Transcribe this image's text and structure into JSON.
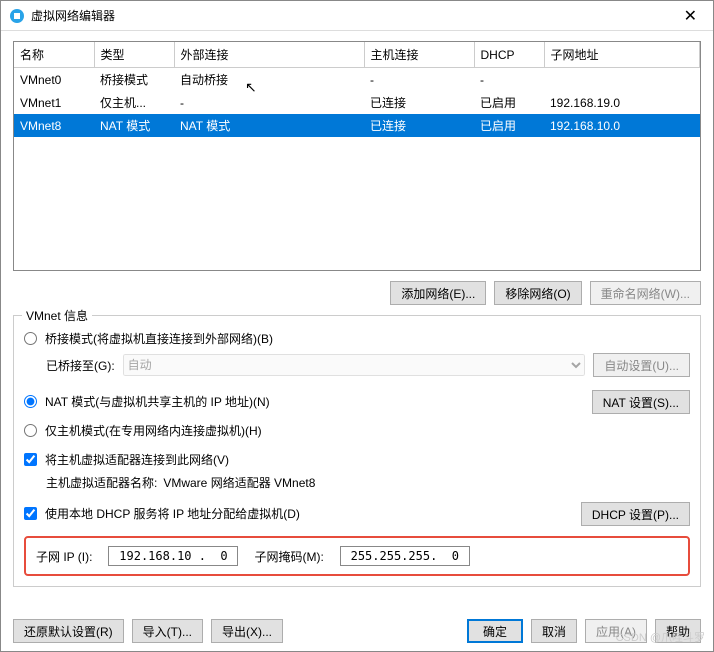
{
  "window": {
    "title": "虚拟网络编辑器"
  },
  "table": {
    "headers": [
      "名称",
      "类型",
      "外部连接",
      "主机连接",
      "DHCP",
      "子网地址"
    ],
    "rows": [
      {
        "cells": [
          "VMnet0",
          "桥接模式",
          "自动桥接",
          "-",
          "-",
          ""
        ],
        "selected": false
      },
      {
        "cells": [
          "VMnet1",
          "仅主机...",
          "-",
          "已连接",
          "已启用",
          "192.168.19.0"
        ],
        "selected": false
      },
      {
        "cells": [
          "VMnet8",
          "NAT 模式",
          "NAT 模式",
          "已连接",
          "已启用",
          "192.168.10.0"
        ],
        "selected": true
      }
    ]
  },
  "buttons_top": {
    "add": "添加网络(E)...",
    "remove": "移除网络(O)",
    "rename": "重命名网络(W)..."
  },
  "group": {
    "legend": "VMnet 信息",
    "bridge_label": "桥接模式(将虚拟机直接连接到外部网络)(B)",
    "bridged_to_label": "已桥接至(G):",
    "bridged_to_value": "自动",
    "auto_settings": "自动设置(U)...",
    "nat_label": "NAT 模式(与虚拟机共享主机的 IP 地址)(N)",
    "nat_settings": "NAT 设置(S)...",
    "hostonly_label": "仅主机模式(在专用网络内连接虚拟机)(H)",
    "host_adapter_check": "将主机虚拟适配器连接到此网络(V)",
    "host_adapter_name_label": "主机虚拟适配器名称:",
    "host_adapter_name_value": "VMware 网络适配器 VMnet8",
    "dhcp_check": "使用本地 DHCP 服务将 IP 地址分配给虚拟机(D)",
    "dhcp_settings": "DHCP 设置(P)..."
  },
  "subnet": {
    "ip_label": "子网 IP (I):",
    "ip_value": "192.168.10 .  0",
    "mask_label": "子网掩码(M):",
    "mask_value": "255.255.255.  0"
  },
  "bottom": {
    "restore": "还原默认设置(R)",
    "import": "导入(T)...",
    "export": "导出(X)...",
    "ok": "确定",
    "cancel": "取消",
    "apply": "应用(A)",
    "help": "帮助"
  },
  "watermark": "CSDN @爪哇斗罗"
}
